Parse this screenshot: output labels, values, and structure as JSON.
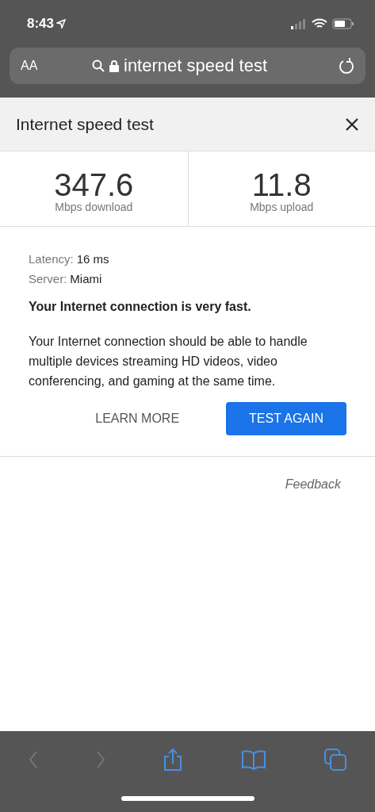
{
  "status_bar": {
    "time": "8:43"
  },
  "address_bar": {
    "text_size": "AA",
    "url": "internet speed test"
  },
  "header": {
    "title": "Internet speed test"
  },
  "results": [
    {
      "value": "347.6",
      "label": "Mbps download"
    },
    {
      "value": "11.8",
      "label": "Mbps upload"
    }
  ],
  "details": [
    {
      "label": "Latency:",
      "value": "16 ms"
    },
    {
      "label": "Server:",
      "value": "Miami"
    }
  ],
  "verdict": "Your Internet connection is very fast.",
  "description": "Your Internet connection should be able to handle multiple devices streaming HD videos, video conferencing, and gaming at the same time.",
  "buttons": [
    {
      "label": "LEARN MORE",
      "kind": "text"
    },
    {
      "label": "TEST AGAIN",
      "kind": "primary"
    }
  ],
  "feedback": "Feedback",
  "toolbar": [
    {
      "kind": "back",
      "disabled": true
    },
    {
      "kind": "forward",
      "disabled": true
    },
    {
      "kind": "share",
      "disabled": false
    },
    {
      "kind": "bookmarks",
      "disabled": false
    },
    {
      "kind": "tabs",
      "disabled": false
    }
  ]
}
